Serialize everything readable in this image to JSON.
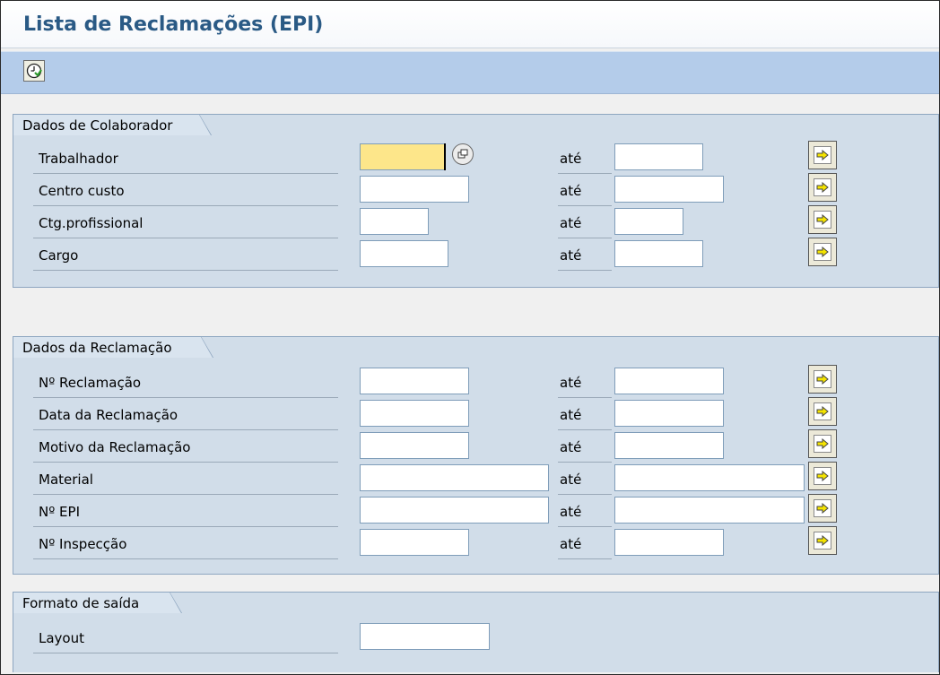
{
  "title": "Lista de Reclamações (EPI)",
  "toolbar": {
    "execute_icon": "clock-execute-icon"
  },
  "sections": {
    "colaborador": {
      "title": "Dados de Colaborador",
      "rows": [
        {
          "label": "Trabalhador",
          "ate": "até"
        },
        {
          "label": "Centro custo",
          "ate": "até"
        },
        {
          "label": "Ctg.profissional",
          "ate": "até"
        },
        {
          "label": "Cargo",
          "ate": "até"
        }
      ]
    },
    "reclamacao": {
      "title": "Dados da Reclamação",
      "rows": [
        {
          "label": "Nº Reclamação",
          "ate": "até"
        },
        {
          "label": "Data da Reclamação",
          "ate": "até"
        },
        {
          "label": "Motivo da Reclamação",
          "ate": "até"
        },
        {
          "label": "Material",
          "ate": "até"
        },
        {
          "label": "Nº EPI",
          "ate": "até"
        },
        {
          "label": "Nº Inspecção",
          "ate": "até"
        }
      ]
    },
    "saida": {
      "title": "Formato de saída",
      "rows": [
        {
          "label": "Layout"
        }
      ]
    }
  },
  "colors": {
    "title": "#2a5a85",
    "toolbar": "#b4ccea",
    "block_bg": "#d1dde9",
    "active_field": "#fde68a",
    "arrow": "#f5e400"
  }
}
